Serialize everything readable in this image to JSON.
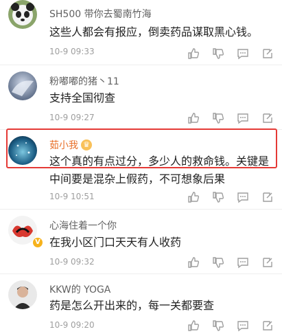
{
  "comments": [
    {
      "name": "SH500 带你去蜀南竹海",
      "text": "这些人都会有报应，倒卖药品谋取黑心钱。",
      "time": "10-9 09:33"
    },
    {
      "name": "粉嘟嘟的猪丶11",
      "text": "支持全国彻查",
      "time": "10-9 09:27"
    },
    {
      "name": "茹小我",
      "text": "这个真的有点过分，多少人的救命钱。关键是中间要是混杂上假药，不可想象后果",
      "time": "10-9 10:51",
      "badge_icon": "crown-badge-icon"
    },
    {
      "name": "心海住着一个你",
      "text": "在我小区门口天天有人收药",
      "time": "10-9 09:32",
      "badge_icon": "verified-v-badge-icon"
    },
    {
      "name": "KKW的 YOGA",
      "text": "药是怎么开出来的，每一关都要查",
      "time": "10-9 09:20"
    }
  ],
  "action_icons": [
    "like-icon",
    "dislike-icon",
    "reply-icon",
    "more-icon"
  ],
  "colors": {
    "highlight": "#e53935",
    "name_highlight": "#e8702a"
  }
}
